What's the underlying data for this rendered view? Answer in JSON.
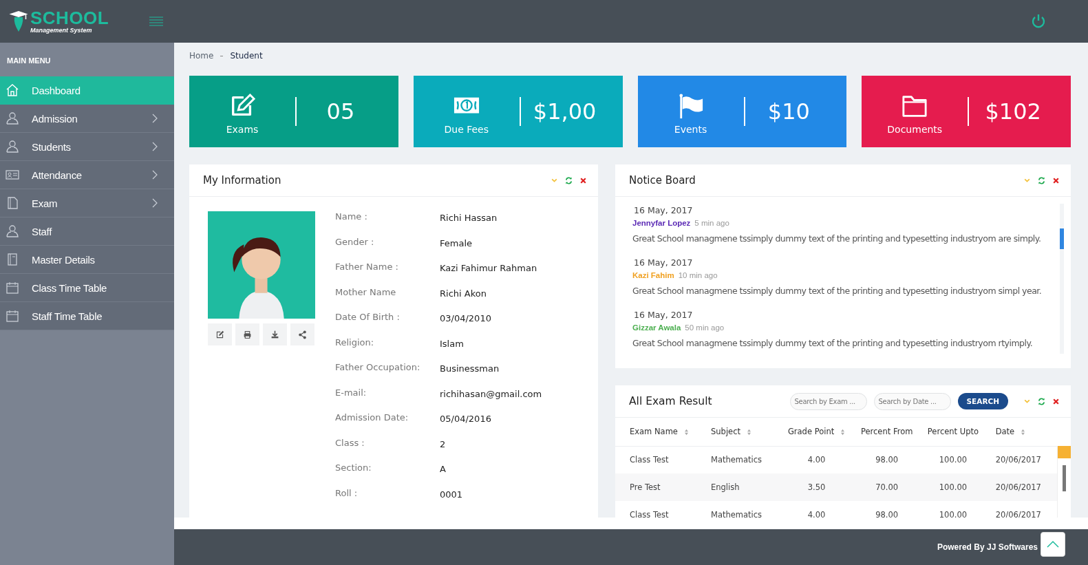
{
  "header": {
    "logo_title": "SCHOOL",
    "logo_subtitle": "Management System"
  },
  "sidebar": {
    "heading": "MAIN MENU",
    "items": [
      {
        "label": "Dashboard",
        "kind": "home",
        "selected": true,
        "expandable": false
      },
      {
        "label": "Admission",
        "kind": "user",
        "selected": false,
        "expandable": true
      },
      {
        "label": "Students",
        "kind": "user",
        "selected": false,
        "expandable": true
      },
      {
        "label": "Attendance",
        "kind": "card",
        "selected": false,
        "expandable": true
      },
      {
        "label": "Exam",
        "kind": "book",
        "selected": false,
        "expandable": true
      },
      {
        "label": "Staff",
        "kind": "user",
        "selected": false,
        "expandable": false
      },
      {
        "label": "Master Details",
        "kind": "notebook",
        "selected": false,
        "expandable": false
      },
      {
        "label": "Class Time Table",
        "kind": "calendar",
        "selected": false,
        "expandable": false
      },
      {
        "label": "Staff Time Table",
        "kind": "calendar",
        "selected": false,
        "expandable": false
      }
    ]
  },
  "breadcrumb": [
    "Home",
    "Student"
  ],
  "stat_cards": [
    {
      "label": "Exams",
      "value": "05",
      "kind": "edit",
      "color": "#069e87"
    },
    {
      "label": "Due Fees",
      "value": "$1,00",
      "kind": "money",
      "color": "#0aabbb"
    },
    {
      "label": "Events",
      "value": "$10",
      "kind": "flag",
      "color": "#2289e6"
    },
    {
      "label": "Documents",
      "value": "$102",
      "kind": "folder",
      "color": "#e51c4e"
    }
  ],
  "my_information": {
    "title": "My Information",
    "fields": [
      {
        "label": "Name :",
        "value": "Richi Hassan"
      },
      {
        "label": "Gender :",
        "value": "Female"
      },
      {
        "label": "Father Name :",
        "value": "Kazi Fahimur Rahman"
      },
      {
        "label": "Mother Name",
        "value": "Richi Akon"
      },
      {
        "label": "Date Of Birth :",
        "value": "03/04/2010"
      },
      {
        "label": "Religion:",
        "value": "Islam"
      },
      {
        "label": "Father Occupation:",
        "value": "Businessman"
      },
      {
        "label": "E-mail:",
        "value": "richihasan@gmail.com"
      },
      {
        "label": "Admission Date:",
        "value": "05/04/2016"
      },
      {
        "label": "Class :",
        "value": "2"
      },
      {
        "label": "Section:",
        "value": "A"
      },
      {
        "label": "Roll :",
        "value": "0001"
      }
    ]
  },
  "notice_board": {
    "title": "Notice Board",
    "notices": [
      {
        "date": "16 May, 2017",
        "author": "Jennyfar Lopez",
        "color": "#5b2ab5",
        "time": "5 min ago",
        "text": "Great School managmene tssimply dummy text of the printing and typesetting industryom are simply."
      },
      {
        "date": "16 May, 2017",
        "author": "Kazi Fahim",
        "color": "#f0a020",
        "time": "10 min ago",
        "text": "Great School managmene tssimply dummy text of the printing and typesetting industryom simpl year."
      },
      {
        "date": "16 May, 2017",
        "author": "Gizzar Awala",
        "color": "#4caf50",
        "time": "50 min ago",
        "text": "Great School managmene tssimply dummy text of the printing and typesetting industryom rtyimply."
      }
    ]
  },
  "exam_results": {
    "title": "All Exam Result",
    "search_exam_placeholder": "Search by Exam ...",
    "search_date_placeholder": "Search by Date ...",
    "search_button": "SEARCH",
    "columns": [
      {
        "label": "Exam Name",
        "sortable": true
      },
      {
        "label": "Subject",
        "sortable": true
      },
      {
        "label": "Grade Point",
        "sortable": true
      },
      {
        "label": "Percent From",
        "sortable": false
      },
      {
        "label": "Percent Upto",
        "sortable": false
      },
      {
        "label": "Date",
        "sortable": true
      }
    ],
    "rows": [
      [
        "Class Test",
        "Mathematics",
        "4.00",
        "98.00",
        "100.00",
        "20/06/2017"
      ],
      [
        "Pre Test",
        "English",
        "3.50",
        "70.00",
        "100.00",
        "20/06/2017"
      ],
      [
        "Class Test",
        "Mathematics",
        "4.00",
        "98.00",
        "100.00",
        "20/06/2017"
      ]
    ]
  },
  "footer": {
    "text": "Powered By JJ Softwares"
  }
}
